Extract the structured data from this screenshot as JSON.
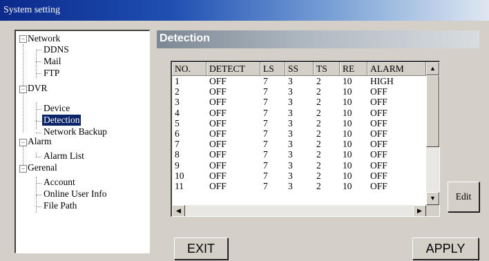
{
  "window": {
    "title": "System setting"
  },
  "tree": {
    "network": "Network",
    "ddns": "DDNS",
    "mail": "Mail",
    "ftp": "FTP",
    "dvr": "DVR",
    "device": "Device",
    "detection": "Detection",
    "network_backup": "Network Backup",
    "alarm": "Alarm",
    "alarm_list": "Alarm List",
    "general": "Gerenal",
    "account": "Account",
    "online_user_info": "Online User Info",
    "file_path": "File Path",
    "toggle_glyph": "−"
  },
  "panel": {
    "title": "Detection"
  },
  "table": {
    "columns": [
      "NO.",
      "DETECT",
      "LS",
      "SS",
      "TS",
      "RE",
      "ALARM"
    ],
    "rows": [
      [
        "1",
        "OFF",
        "7",
        "3",
        "2",
        "10",
        "HIGH"
      ],
      [
        "2",
        "OFF",
        "7",
        "3",
        "2",
        "10",
        "OFF"
      ],
      [
        "3",
        "OFF",
        "7",
        "3",
        "2",
        "10",
        "OFF"
      ],
      [
        "4",
        "OFF",
        "7",
        "3",
        "2",
        "10",
        "OFF"
      ],
      [
        "5",
        "OFF",
        "7",
        "3",
        "2",
        "10",
        "OFF"
      ],
      [
        "6",
        "OFF",
        "7",
        "3",
        "2",
        "10",
        "OFF"
      ],
      [
        "7",
        "OFF",
        "7",
        "3",
        "2",
        "10",
        "OFF"
      ],
      [
        "8",
        "OFF",
        "7",
        "3",
        "2",
        "10",
        "OFF"
      ],
      [
        "9",
        "OFF",
        "7",
        "3",
        "2",
        "10",
        "OFF"
      ],
      [
        "10",
        "OFF",
        "7",
        "3",
        "2",
        "10",
        "OFF"
      ],
      [
        "11",
        "OFF",
        "7",
        "3",
        "2",
        "10",
        "OFF"
      ]
    ]
  },
  "scroll_icons": {
    "up": "▲",
    "down": "▼",
    "left": "◀",
    "right": "▶"
  },
  "buttons": {
    "edit": "Edit",
    "exit": "EXIT",
    "apply": "APPLY"
  }
}
